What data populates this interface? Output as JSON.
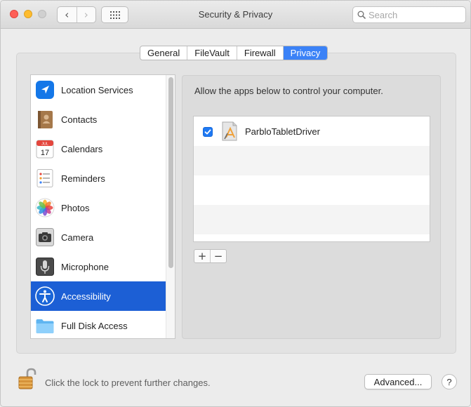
{
  "window": {
    "title": "Security & Privacy"
  },
  "toolbar": {
    "back_glyph": "‹",
    "forward_glyph": "›",
    "search_placeholder": "Search"
  },
  "tabs": [
    {
      "label": "General",
      "active": false
    },
    {
      "label": "FileVault",
      "active": false
    },
    {
      "label": "Firewall",
      "active": false
    },
    {
      "label": "Privacy",
      "active": true
    }
  ],
  "sidebar": {
    "items": [
      {
        "label": "Location Services",
        "icon": "location-arrow-icon"
      },
      {
        "label": "Contacts",
        "icon": "contacts-book-icon"
      },
      {
        "label": "Calendars",
        "icon": "calendar-icon",
        "icon_text": {
          "month": "JUL",
          "day": "17"
        }
      },
      {
        "label": "Reminders",
        "icon": "reminders-list-icon"
      },
      {
        "label": "Photos",
        "icon": "photos-flower-icon"
      },
      {
        "label": "Camera",
        "icon": "camera-icon"
      },
      {
        "label": "Microphone",
        "icon": "microphone-icon"
      },
      {
        "label": "Accessibility",
        "icon": "accessibility-icon",
        "selected": true
      },
      {
        "label": "Full Disk Access",
        "icon": "folder-icon"
      }
    ]
  },
  "main": {
    "description": "Allow the apps below to control your computer.",
    "apps": [
      {
        "name": "ParbloTabletDriver",
        "checked": true,
        "icon": "app-generic-icon"
      }
    ],
    "add_glyph": "+",
    "remove_glyph": "−"
  },
  "footer": {
    "lock_text": "Click the lock to prevent further changes.",
    "advanced_label": "Advanced...",
    "help_label": "?"
  },
  "colors": {
    "accent": "#3b82f7",
    "selection": "#1c5fd5",
    "checkbox": "#1f79f3",
    "close": "#fe5f57",
    "minimize": "#febc2e",
    "zoom_disabled": "#d0d0d0"
  }
}
